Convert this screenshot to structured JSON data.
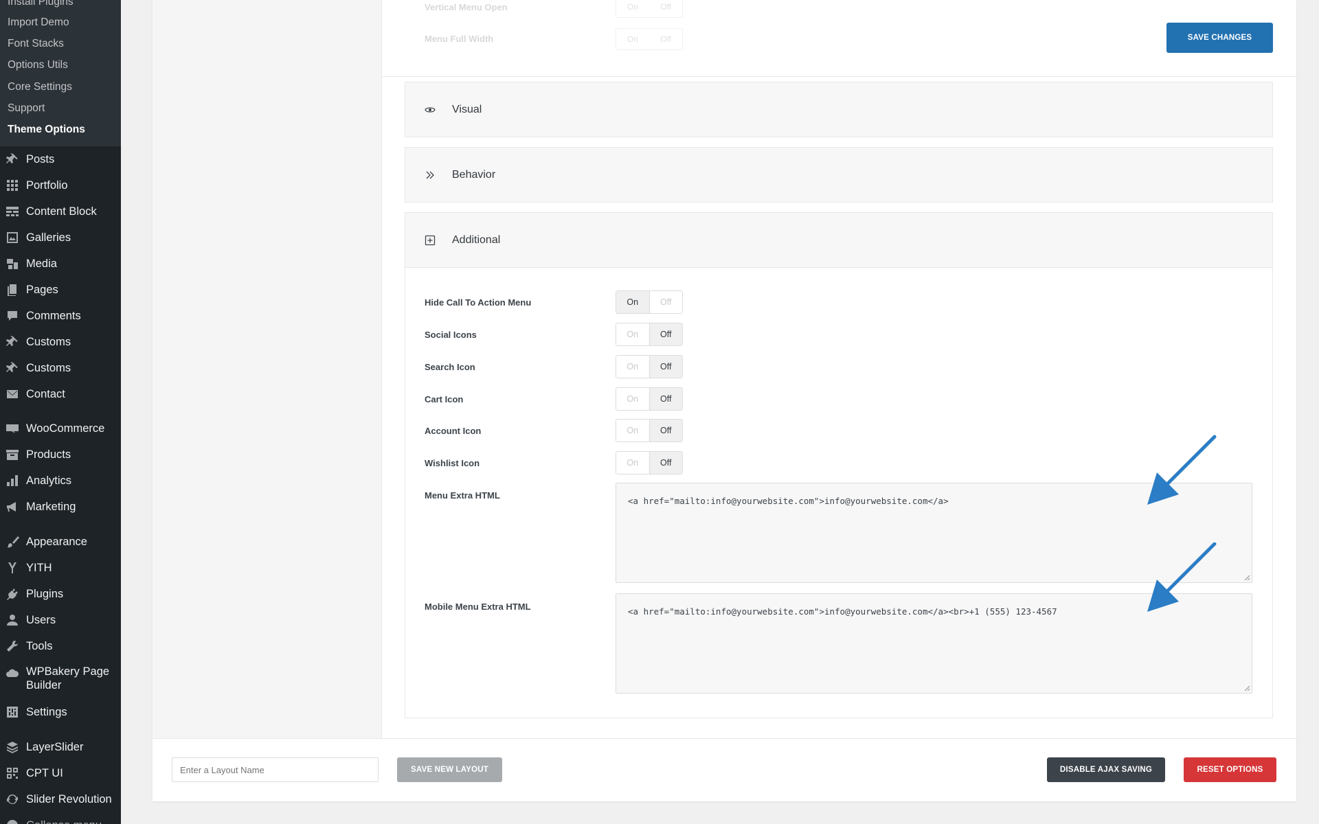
{
  "sidebar": {
    "submenu": [
      "Install Plugins",
      "Import Demo",
      "Font Stacks",
      "Options Utils",
      "Core Settings",
      "Support",
      "Theme Options"
    ],
    "current_submenu": "Theme Options",
    "menu": [
      {
        "label": "Posts",
        "icon": "pin-icon"
      },
      {
        "label": "Portfolio",
        "icon": "grid-icon"
      },
      {
        "label": "Content Block",
        "icon": "blocks-icon"
      },
      {
        "label": "Galleries",
        "icon": "gallery-icon"
      },
      {
        "label": "Media",
        "icon": "media-icon"
      },
      {
        "label": "Pages",
        "icon": "pages-icon"
      },
      {
        "label": "Comments",
        "icon": "comment-icon"
      },
      {
        "label": "Customs",
        "icon": "pin-icon"
      },
      {
        "label": "Customs",
        "icon": "pin-icon"
      },
      {
        "label": "Contact",
        "icon": "mail-icon"
      },
      {
        "label": "WooCommerce",
        "icon": "woo-icon"
      },
      {
        "label": "Products",
        "icon": "archive-icon"
      },
      {
        "label": "Analytics",
        "icon": "bar-chart-icon"
      },
      {
        "label": "Marketing",
        "icon": "megaphone-icon"
      },
      {
        "label": "Appearance",
        "icon": "brush-icon"
      },
      {
        "label": "YITH",
        "icon": "yith-icon"
      },
      {
        "label": "Plugins",
        "icon": "plug-icon"
      },
      {
        "label": "Users",
        "icon": "user-icon"
      },
      {
        "label": "Tools",
        "icon": "wrench-icon"
      },
      {
        "label": "WPBakery Page Builder",
        "icon": "cloud-icon"
      },
      {
        "label": "Settings",
        "icon": "settings-icon"
      },
      {
        "label": "LayerSlider",
        "icon": "layers-icon"
      },
      {
        "label": "CPT UI",
        "icon": "qr-icon"
      },
      {
        "label": "Slider Revolution",
        "icon": "refresh-icon"
      },
      {
        "label": "Collapse menu",
        "icon": "collapse-icon"
      }
    ]
  },
  "faded_options": [
    {
      "label": "Vertical Menu Open",
      "on": "On",
      "off": "Off"
    },
    {
      "label": "Menu Full Width",
      "on": "On",
      "off": "Off"
    }
  ],
  "buttons": {
    "save_changes": "SAVE CHANGES",
    "save_new_layout": "SAVE NEW LAYOUT",
    "disable_ajax_saving": "DISABLE AJAX SAVING",
    "reset_options": "RESET OPTIONS"
  },
  "sections": {
    "visual": "Visual",
    "behavior": "Behavior",
    "additional": "Additional"
  },
  "options": [
    {
      "label": "Hide Call To Action Menu",
      "on": "On",
      "off": "Off",
      "value": "On"
    },
    {
      "label": "Social Icons",
      "on": "On",
      "off": "Off",
      "value": "Off"
    },
    {
      "label": "Search Icon",
      "on": "On",
      "off": "Off",
      "value": "Off"
    },
    {
      "label": "Cart Icon",
      "on": "On",
      "off": "Off",
      "value": "Off"
    },
    {
      "label": "Account Icon",
      "on": "On",
      "off": "Off",
      "value": "Off"
    },
    {
      "label": "Wishlist Icon",
      "on": "On",
      "off": "Off",
      "value": "Off"
    }
  ],
  "menu_extra_html": {
    "label": "Menu Extra HTML",
    "value": "<a href=\"mailto:info@yourwebsite.com\">info@yourwebsite.com</a>"
  },
  "mobile_menu_extra_html": {
    "label": "Mobile Menu Extra HTML",
    "value": "<a href=\"mailto:info@yourwebsite.com\">info@yourwebsite.com</a><br>+1 (555) 123-4567"
  },
  "layout_input": {
    "placeholder": "Enter a Layout Name"
  },
  "colors": {
    "primary": "#2271b1",
    "danger": "#d63638",
    "dark": "#3c434a",
    "arrow": "#2b7dc5"
  }
}
